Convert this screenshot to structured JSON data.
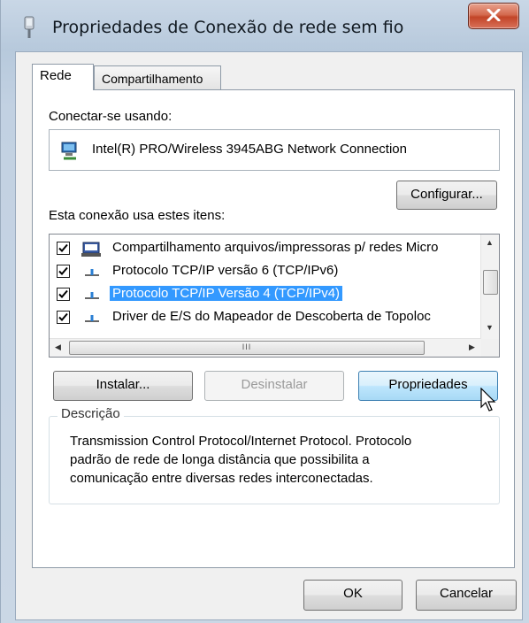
{
  "window": {
    "title": "Propriedades de Conexão de rede sem fio",
    "close_icon": "close-icon"
  },
  "tabs": [
    {
      "label": "Rede",
      "active": true
    },
    {
      "label": "Compartilhamento",
      "active": false
    }
  ],
  "connect": {
    "label": "Conectar-se usando:",
    "adapter_name": "Intel(R) PRO/Wireless 3945ABG Network Connection",
    "adapter_icon": "network-adapter-icon",
    "configure_label": "Configurar..."
  },
  "items": {
    "label": "Esta conexão usa estes itens:",
    "list": [
      {
        "text": "Compartilhamento arquivos/impressoras p/ redes Micro",
        "checked": true,
        "icon": "printer-share-icon",
        "selected": false
      },
      {
        "text": "Protocolo TCP/IP versão 6 (TCP/IPv6)",
        "checked": true,
        "icon": "protocol-icon",
        "selected": false
      },
      {
        "text": "Protocolo TCP/IP Versão 4 (TCP/IPv4)",
        "checked": true,
        "icon": "protocol-icon",
        "selected": true
      },
      {
        "text": "Driver de E/S do Mapeador de Descoberta de Topoloc",
        "checked": true,
        "icon": "protocol-icon",
        "selected": false
      }
    ],
    "hscroll_grip": "III"
  },
  "buttons": {
    "install": "Instalar...",
    "uninstall": "Desinstalar",
    "properties": "Propriedades",
    "ok": "OK",
    "cancel": "Cancelar"
  },
  "description": {
    "legend": "Descrição",
    "lines": [
      "Transmission Control Protocol/Internet Protocol. Protocolo",
      "padrão de rede de longa distância que possibilita a",
      "comunicação entre diversas redes interconectadas."
    ]
  },
  "colors": {
    "selection": "#3399ff",
    "close_button": "#c24427",
    "hover_button": "#bee6fd"
  }
}
